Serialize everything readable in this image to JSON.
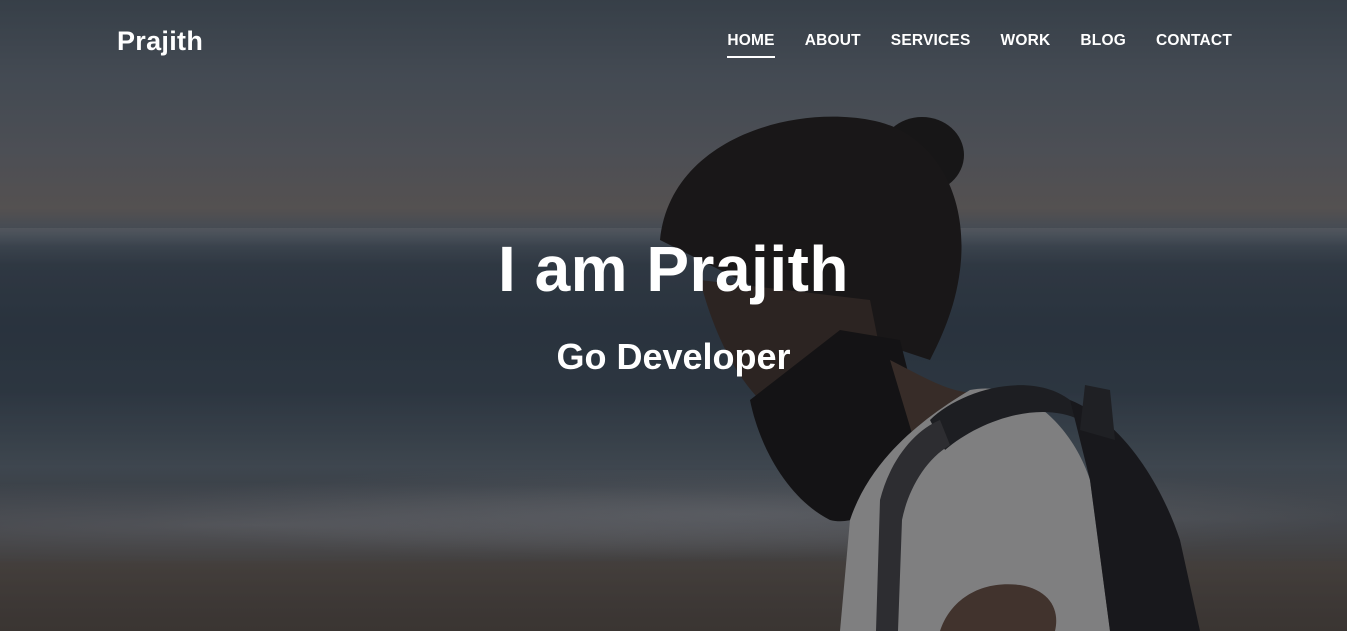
{
  "nav": {
    "brand": "Prajith",
    "items": [
      {
        "label": "HOME",
        "active": true
      },
      {
        "label": "ABOUT",
        "active": false
      },
      {
        "label": "SERVICES",
        "active": false
      },
      {
        "label": "WORK",
        "active": false
      },
      {
        "label": "BLOG",
        "active": false
      },
      {
        "label": "CONTACT",
        "active": false
      }
    ]
  },
  "hero": {
    "title": "I am Prajith",
    "subtitle": "Go Developer"
  },
  "colors": {
    "text": "#ffffff",
    "overlay": "rgba(20,22,28,0.35)"
  }
}
